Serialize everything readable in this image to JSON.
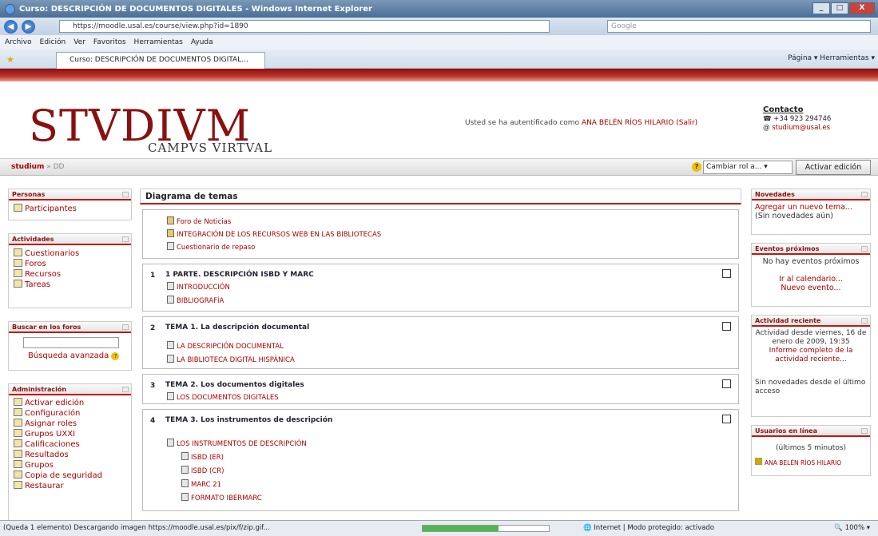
{
  "window": {
    "title": "Curso: DESCRIPCIÓN DE DOCUMENTOS DIGITALES - Windows Internet Explorer"
  },
  "address": {
    "url": "https://moodle.usal.es/course/view.php?id=1890",
    "search_placeholder": "Google"
  },
  "menu": [
    "Archivo",
    "Edición",
    "Ver",
    "Favoritos",
    "Herramientas",
    "Ayuda"
  ],
  "tab": {
    "label": "Curso: DESCRIPCIÓN DE DOCUMENTOS DIGITAL..."
  },
  "ie_tools": "Página ▾  Herramientas ▾",
  "header": {
    "logo": "STVDIVM",
    "logo_sub": "CAMPVS VIRTVAL",
    "auth_prefix": "Usted se ha autentificado como",
    "user": "ANA BELÉN RÍOS HILARIO",
    "logout": "(Salir)",
    "contact_title": "Contacto",
    "phone": "+34 923 294746",
    "email": "studium@usal.es"
  },
  "navbar": {
    "home": "studium",
    "course": "DD",
    "role_select": "Cambiar rol a...",
    "edit_button": "Activar edición"
  },
  "blocks": {
    "personas": {
      "title": "Personas",
      "items": [
        "Participantes"
      ]
    },
    "actividades": {
      "title": "Actividades",
      "items": [
        "Cuestionarios",
        "Foros",
        "Recursos",
        "Tareas"
      ]
    },
    "buscar": {
      "title": "Buscar en los foros",
      "link": "Búsqueda avanzada"
    },
    "admin": {
      "title": "Administración",
      "items": [
        "Activar edición",
        "Configuración",
        "Asignar roles",
        "Grupos UXXI",
        "Calificaciones",
        "Resultados",
        "Grupos",
        "Copia de seguridad",
        "Restaurar"
      ]
    },
    "novedades": {
      "title": "Novedades",
      "link": "Agregar un nuevo tema...",
      "note": "(Sin novedades aún)"
    },
    "eventos": {
      "title": "Eventos próximos",
      "text": "No hay eventos próximos",
      "link1": "Ir al calendario...",
      "link2": "Nuevo evento..."
    },
    "actividad": {
      "title": "Actividad reciente",
      "text": "Actividad desde viernes, 16 de enero de 2009, 19:35",
      "link": "Informe completo de la actividad reciente...",
      "note": "Sin novedades desde el último acceso"
    },
    "usuarios": {
      "title": "Usuarios en línea",
      "note": "(últimos 5 minutos)",
      "user": "ANA BELÉN RÍOS HILARIO"
    }
  },
  "main": {
    "title": "Diagrama de temas",
    "intro": [
      "Foro de Noticias",
      "INTEGRACIÓN DE LOS RECURSOS WEB EN LAS BIBLIOTECAS",
      "Cuestionario de repaso"
    ],
    "sections": [
      {
        "num": "1",
        "title": "1 PARTE. DESCRIPCIÓN ISBD Y MARC",
        "items": [
          "INTRODUCCIÓN",
          "BIBLIOGRAFÍA"
        ]
      },
      {
        "num": "2",
        "title": "TEMA 1. La descripción documental",
        "items": [
          "LA DESCRIPCIÓN DOCUMENTAL",
          "LA BIBLIOTECA DIGITAL HISPÁNICA"
        ]
      },
      {
        "num": "3",
        "title": "TEMA 2. Los documentos digitales",
        "items": [
          "LOS DOCUMENTOS DIGITALES"
        ]
      },
      {
        "num": "4",
        "title": "TEMA 3. Los instrumentos de descripción",
        "items": [
          "LOS INSTRUMENTOS DE DESCRIPCIÓN",
          "ISBD (ER)",
          "ISBD (CR)",
          "MARC 21",
          "FORMATO IBERMARC"
        ]
      }
    ]
  },
  "status": {
    "text": "(Queda 1 elemento) Descargando imagen https://moodle.usal.es/pix/f/zip.gif...",
    "zone": "Internet | Modo protegido: activado",
    "zoom": "100%",
    "progress": 0.6
  }
}
